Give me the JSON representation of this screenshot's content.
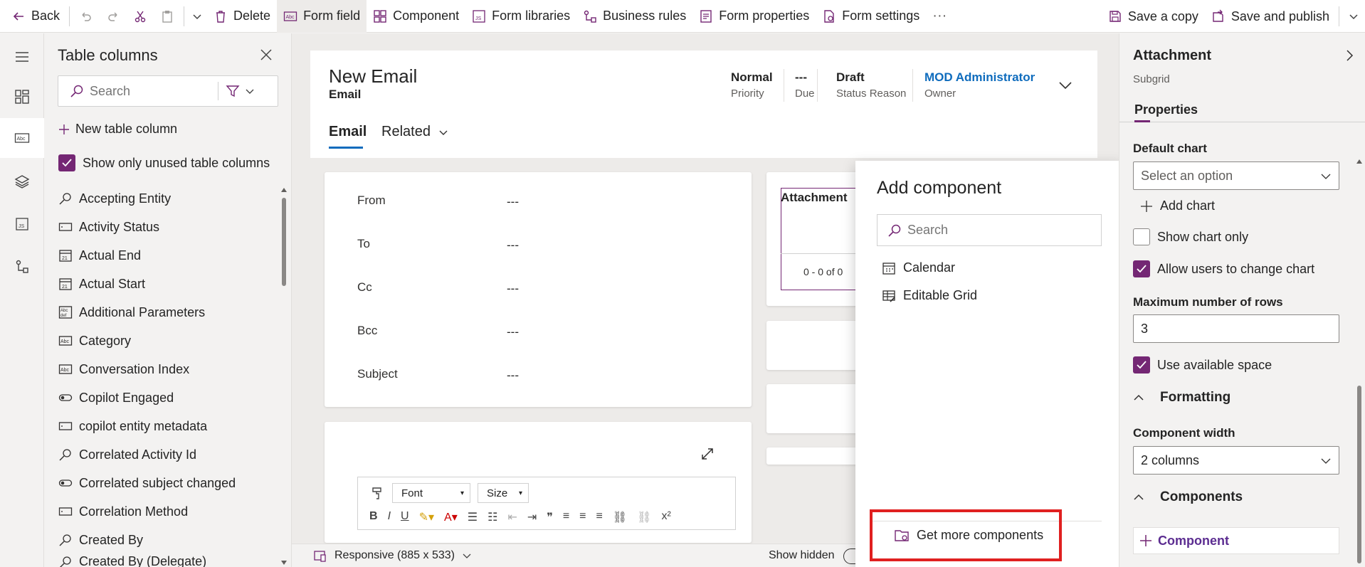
{
  "toolbar": {
    "back": "Back",
    "delete": "Delete",
    "form_field": "Form field",
    "component": "Component",
    "form_libraries": "Form libraries",
    "business_rules": "Business rules",
    "form_properties": "Form properties",
    "form_settings": "Form settings",
    "more": "···",
    "save_copy": "Save a copy",
    "save_publish": "Save and publish"
  },
  "columns_panel": {
    "title": "Table columns",
    "search_placeholder": "Search",
    "new_column": "New table column",
    "show_unused": "Show only unused table columns",
    "items": [
      {
        "label": "Accepting Entity",
        "icon": "lookup-icon"
      },
      {
        "label": "Activity Status",
        "icon": "option-set-icon"
      },
      {
        "label": "Actual End",
        "icon": "calendar-icon"
      },
      {
        "label": "Actual Start",
        "icon": "calendar-icon"
      },
      {
        "label": "Additional Parameters",
        "icon": "multiline-text-icon"
      },
      {
        "label": "Category",
        "icon": "text-icon"
      },
      {
        "label": "Conversation Index",
        "icon": "text-icon"
      },
      {
        "label": "Copilot Engaged",
        "icon": "toggle-icon"
      },
      {
        "label": "copilot entity metadata",
        "icon": "option-set-icon"
      },
      {
        "label": "Correlated Activity Id",
        "icon": "lookup-icon"
      },
      {
        "label": "Correlated subject changed",
        "icon": "toggle-icon"
      },
      {
        "label": "Correlation Method",
        "icon": "option-set-icon"
      },
      {
        "label": "Created By",
        "icon": "lookup-icon"
      },
      {
        "label": "Created By (Delegate)",
        "icon": "lookup-icon"
      }
    ]
  },
  "form": {
    "title": "New Email",
    "entity": "Email",
    "header_fields": [
      {
        "value": "Normal",
        "label": "Priority"
      },
      {
        "value": "---",
        "label": "Due"
      },
      {
        "value": "Draft",
        "label": "Status Reason"
      },
      {
        "value": "MOD Administrator",
        "label": "Owner"
      }
    ],
    "tabs": [
      "Email",
      "Related"
    ],
    "fields": [
      {
        "label": "From",
        "value": "---"
      },
      {
        "label": "To",
        "value": "---"
      },
      {
        "label": "Cc",
        "value": "---"
      },
      {
        "label": "Bcc",
        "value": "---"
      },
      {
        "label": "Subject",
        "value": "---"
      }
    ],
    "attachment_title": "Attachment",
    "attachment_count": "0 - 0 of 0",
    "rte": {
      "font": "Font",
      "size": "Size"
    }
  },
  "statusbar": {
    "responsive": "Responsive (885 x 533)",
    "show_hidden": "Show hidden"
  },
  "add_component": {
    "title": "Add component",
    "search_placeholder": "Search",
    "items": [
      "Calendar",
      "Editable Grid"
    ],
    "get_more": "Get more components"
  },
  "properties": {
    "title": "Attachment",
    "subtitle": "Subgrid",
    "tab": "Properties",
    "default_chart_label": "Default chart",
    "default_chart_value": "Select an option",
    "add_chart": "Add chart",
    "show_chart_only": "Show chart only",
    "show_chart_only_checked": false,
    "allow_change_chart": "Allow users to change chart",
    "allow_change_chart_checked": true,
    "max_rows_label": "Maximum number of rows",
    "max_rows_value": "3",
    "use_space": "Use available space",
    "use_space_checked": true,
    "formatting": "Formatting",
    "width_label": "Component width",
    "width_value": "2 columns",
    "components": "Components",
    "component_btn": "Component"
  },
  "colors": {
    "accent": "#742774",
    "link": "#0f6cbd",
    "highlight": "#e02020"
  }
}
